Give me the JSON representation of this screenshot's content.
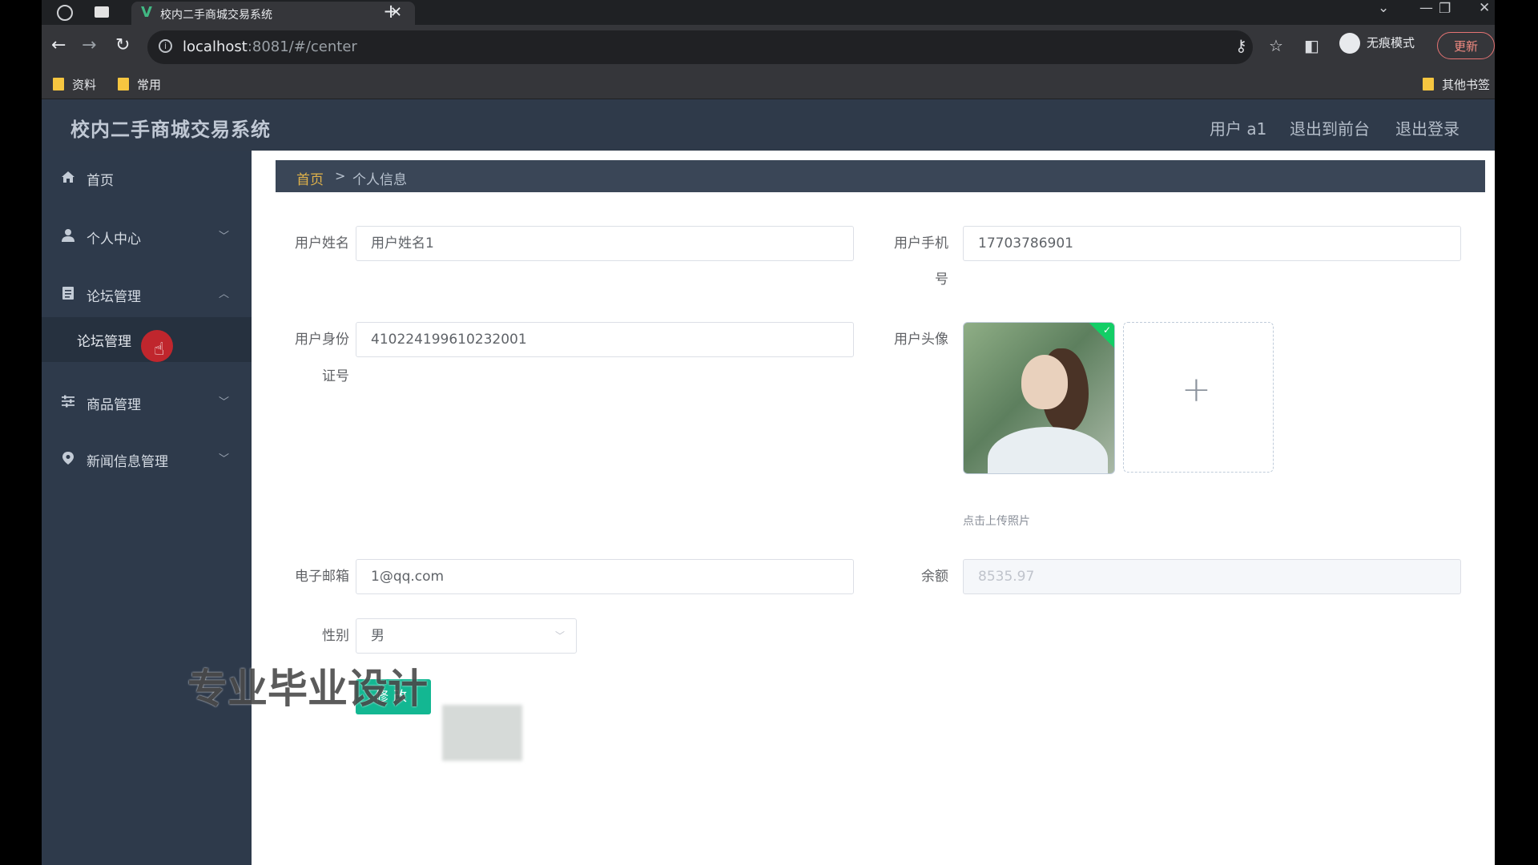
{
  "browser": {
    "tab_title": "校内二手商城交易系统",
    "url_host": "localhost",
    "url_rest": ":8081/#/center",
    "incognito_label": "无痕模式",
    "update_label": "更新",
    "bookmarks": [
      "资料",
      "常用"
    ],
    "other_bookmarks": "其他书签"
  },
  "app": {
    "title": "校内二手商城交易系统",
    "header_links": [
      "用户 a1",
      "退出到前台",
      "退出登录"
    ]
  },
  "sidebar": {
    "items": [
      {
        "label": "首页",
        "icon": "home-icon"
      },
      {
        "label": "个人中心",
        "icon": "user-icon"
      },
      {
        "label": "论坛管理",
        "icon": "document-icon"
      },
      {
        "label": "商品管理",
        "icon": "sliders-icon"
      },
      {
        "label": "新闻信息管理",
        "icon": "location-pin-icon"
      }
    ],
    "submenu_item": "论坛管理"
  },
  "breadcrumb": {
    "home": "首页",
    "separator": ">",
    "current": "个人信息"
  },
  "form": {
    "name_label": "用户姓名",
    "name_value": "用户姓名1",
    "phone_label_line1": "用户手机",
    "phone_label_line2": "号",
    "phone_value": "17703786901",
    "idcard_label_line1": "用户身份",
    "idcard_label_line2": "证号",
    "idcard_value": "410224199610232001",
    "avatar_label": "用户头像",
    "upload_hint": "点击上传照片",
    "email_label": "电子邮箱",
    "email_value": "1@qq.com",
    "balance_label": "余额",
    "balance_value": "8535.97",
    "gender_label": "性别",
    "gender_value": "男",
    "submit_label": "修改"
  },
  "overlay": {
    "watermark": "专业毕业设计"
  }
}
